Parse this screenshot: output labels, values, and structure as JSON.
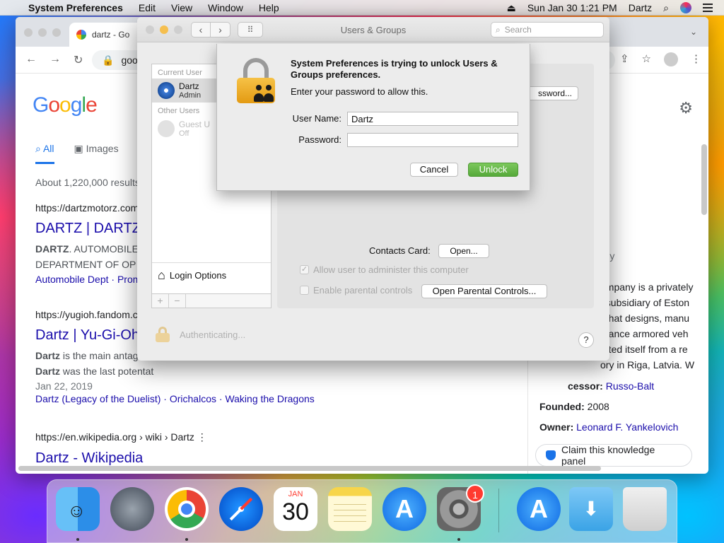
{
  "menubar": {
    "app": "System Preferences",
    "items": [
      "Edit",
      "View",
      "Window",
      "Help"
    ],
    "datetime": "Sun Jan 30  1:21 PM",
    "user": "Dartz"
  },
  "chrome": {
    "tab_title": "dartz - Go",
    "url": "goog",
    "google_tabs": [
      "All",
      "Images"
    ],
    "results_count": "About 1,220,000 results",
    "results": [
      {
        "url": "https://dartzmotorz.com",
        "title": "DARTZ | DARTZ",
        "snippet1_bold": "DARTZ",
        "snippet1": ". AUTOMOBILE",
        "snippet2": "DEPARTMENT OF OP",
        "links": [
          "Automobile Dept",
          "Prom"
        ]
      },
      {
        "url": "https://yugioh.fandom.c",
        "title": "Dartz | Yu-Gi-Oh",
        "snippet1_bold": "Dartz",
        "snippet1": " is the main antag",
        "snippet2_bold": "Dartz",
        "snippet2": " was the last potentat",
        "date": "Jan 22, 2019",
        "links": [
          "Dartz (Legacy of the Duelist)",
          "Orichalcos",
          "Waking the Dragons"
        ]
      },
      {
        "url": "https://en.wikipedia.org › wiki › Dartz",
        "title": "Dartz - Wikipedia"
      }
    ],
    "knowledge_panel": {
      "name": "rtz",
      "subtitle": "pany",
      "desc": [
        "ompany is a privately",
        ", subsidiary of Eston",
        ", that designs, manu",
        "mance armored veh",
        "tuted itself from a re",
        "ory in Riga, Latvia. W"
      ],
      "predecessor_label": "cessor:",
      "predecessor_value": "Russo-Balt",
      "founded_label": "Founded:",
      "founded_value": "2008",
      "owner_label": "Owner:",
      "owner_value": "Leonard F. Yankelovich",
      "claim": "Claim this knowledge panel"
    }
  },
  "syspref": {
    "title": "Users & Groups",
    "search_placeholder": "Search",
    "current_user_hdr": "Current User",
    "current_user_name": "Dartz",
    "current_user_role": "Admin",
    "other_users_hdr": "Other Users",
    "guest_name": "Guest U",
    "guest_role": "Off",
    "login_options": "Login Options",
    "change_password_btn": "ssword...",
    "contacts_card_label": "Contacts Card:",
    "open_btn": "Open...",
    "allow_admin": "Allow user to administer this computer",
    "enable_parental": "Enable parental controls",
    "open_parental_btn": "Open Parental Controls...",
    "authenticating": "Authenticating...",
    "help": "?"
  },
  "sheet": {
    "title": "System Preferences is trying to unlock Users & Groups preferences.",
    "subtitle": "Enter your password to allow this.",
    "username_label": "User Name:",
    "username_value": "Dartz",
    "password_label": "Password:",
    "password_value": "",
    "cancel": "Cancel",
    "unlock": "Unlock"
  },
  "dock": {
    "calendar_month": "JAN",
    "calendar_day": "30",
    "syspref_badge": "1"
  },
  "colors": {
    "unlock_green": "#5cb03f",
    "link_blue": "#1a0dab",
    "badge_red": "#ff3b30"
  }
}
